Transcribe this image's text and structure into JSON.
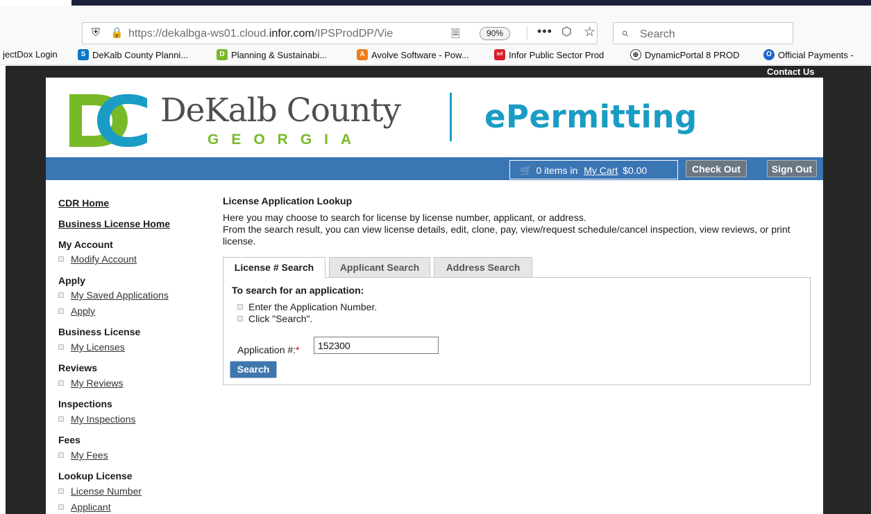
{
  "browser": {
    "url_prefix": "https://dekalbga-ws01.cloud.",
    "url_domain": "infor.com",
    "url_suffix": "/IPSProdDP/Vie",
    "zoom": "90%",
    "search_placeholder": "Search",
    "bookmarks": [
      {
        "label": "jectDox Login",
        "icon": "none",
        "color": ""
      },
      {
        "label": "DeKalb County Planni...",
        "icon": "sharepoint-icon",
        "color": "#0b78c8"
      },
      {
        "label": "Planning & Sustainabi...",
        "icon": "dc-logo-icon",
        "color": "#78b928"
      },
      {
        "label": "Avolve Software - Pow...",
        "icon": "avolve-icon",
        "color": "#f07c1e"
      },
      {
        "label": "Infor Public Sector Prod",
        "icon": "infor-icon",
        "color": "#d81e2a"
      },
      {
        "label": "DynamicPortal 8 PROD",
        "icon": "globe-icon",
        "color": "#333333"
      },
      {
        "label": "Official Payments -",
        "icon": "op-icon",
        "color": "#1d64c8"
      }
    ]
  },
  "header": {
    "contact_us": "Contact Us",
    "county_name": "DeKalb County",
    "state_name": "GEORGIA",
    "brand": "ePermitting",
    "colors": {
      "green": "#78b928",
      "blue": "#1a9cc4",
      "navbar": "#3a75b4"
    }
  },
  "cart": {
    "count": "0",
    "items_in": "items in",
    "link": "My Cart",
    "total": "$0.00",
    "checkout_label": "Check Out",
    "signout_label": "Sign Out"
  },
  "sidebar": {
    "cdr_home": "CDR Home",
    "business_license_home": "Business License Home",
    "sections": [
      {
        "title": "My Account",
        "items": [
          "Modify Account"
        ]
      },
      {
        "title": "Apply",
        "items": [
          "My Saved Applications",
          "Apply"
        ]
      },
      {
        "title": "Business License",
        "items": [
          "My Licenses"
        ]
      },
      {
        "title": "Reviews",
        "items": [
          "My Reviews"
        ]
      },
      {
        "title": "Inspections",
        "items": [
          "My Inspections"
        ]
      },
      {
        "title": "Fees",
        "items": [
          "My Fees"
        ]
      },
      {
        "title": "Lookup License",
        "items": [
          "License Number",
          "Applicant"
        ]
      }
    ]
  },
  "main": {
    "title": "License Application Lookup",
    "intro_line1": "Here you may choose to search for license by license number, applicant, or address.",
    "intro_line2": "From the search result, you can view license details, edit, clone, pay, view/request schedule/cancel inspection, view reviews, or print license.",
    "tabs": [
      "License # Search",
      "Applicant Search",
      "Address Search"
    ],
    "active_tab": "License # Search",
    "panel_title": "To search for an application:",
    "steps": [
      "Enter the Application Number.",
      "Click \"Search\"."
    ],
    "field_label": "Application #:",
    "required_mark": "*",
    "field_value": "152300",
    "search_label": "Search"
  }
}
